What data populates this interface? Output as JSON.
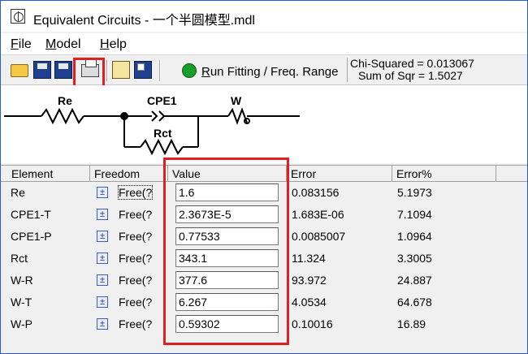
{
  "window": {
    "title": "Equivalent Circuits - 一个半圆模型.mdl"
  },
  "menu": {
    "items": [
      {
        "label": "File",
        "accel": "F",
        "rest": "ile"
      },
      {
        "label": "Model",
        "accel": "M",
        "rest": "odel"
      },
      {
        "label": "Help",
        "accel": "H",
        "rest": "elp"
      }
    ]
  },
  "toolbar": {
    "run_label": "Run Fitting / Freq. Range",
    "run_accel": "R",
    "run_rest": "un Fitting / Freq. Range",
    "buttons": [
      "open-icon",
      "save-icon",
      "save-as-icon",
      "print-icon",
      "clipboard-icon",
      "save-z-icon"
    ],
    "highlight_color": "#e02020",
    "run_color": "#1a9e2a"
  },
  "stats": {
    "chi_squared": "Chi-Squared = 0.013067",
    "sum_of_sqr": "Sum of Sqr = 1.5027"
  },
  "circuit": {
    "labels": {
      "re": "Re",
      "cpe1": "CPE1",
      "w": "W",
      "rct": "Rct"
    }
  },
  "table": {
    "headers": [
      "Element",
      "Freedom",
      "Value",
      "Error",
      "Error%"
    ],
    "rows": [
      {
        "element": "Re",
        "freedom": "Free(?",
        "value": "1.6",
        "error": "0.083156",
        "error_pct": "5.1973"
      },
      {
        "element": "CPE1-T",
        "freedom": "Free(?",
        "value": "2.3673E-5",
        "error": "1.683E-06",
        "error_pct": "7.1094"
      },
      {
        "element": "CPE1-P",
        "freedom": "Free(?",
        "value": "0.77533",
        "error": "0.0085007",
        "error_pct": "1.0964"
      },
      {
        "element": "Rct",
        "freedom": "Free(?",
        "value": "343.1",
        "error": "11.324",
        "error_pct": "3.3005"
      },
      {
        "element": "W-R",
        "freedom": "Free(?",
        "value": "377.6",
        "error": "93.972",
        "error_pct": "24.887"
      },
      {
        "element": "W-T",
        "freedom": "Free(?",
        "value": "6.267",
        "error": "4.0534",
        "error_pct": "64.678"
      },
      {
        "element": "W-P",
        "freedom": "Free(?",
        "value": "0.59302",
        "error": "0.10016",
        "error_pct": "16.89"
      }
    ],
    "pm_symbol": "±"
  }
}
